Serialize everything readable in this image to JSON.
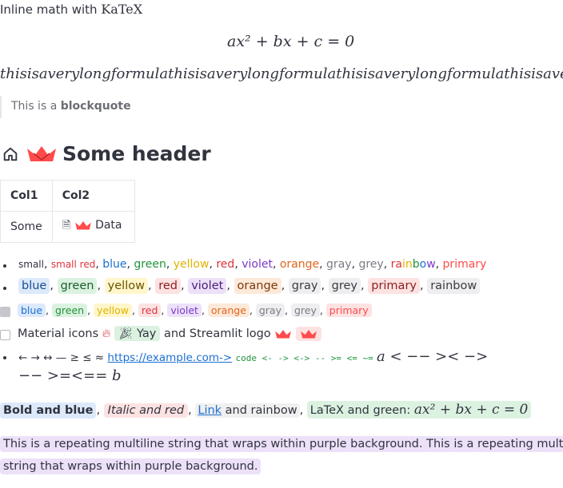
{
  "inline_math": {
    "prefix": "Inline math with ",
    "katex": "KaTeX"
  },
  "formula": "ax² + bx + c = 0",
  "long_formula": "thisisaverylongformulathisisaverylongformulathisisaverylongformulathisisave",
  "blockquote": {
    "prefix": "This is a ",
    "bold": "blockquote"
  },
  "header": {
    "title": "Some header"
  },
  "table": {
    "headers": [
      "Col1",
      "Col2"
    ],
    "rows": [
      [
        "Some",
        "Data"
      ]
    ]
  },
  "list1": {
    "small": "small",
    "small_red": "small red",
    "items": [
      {
        "text": "blue",
        "color": "#1c6fd1"
      },
      {
        "text": "green",
        "color": "#21943c"
      },
      {
        "text": "yellow",
        "color": "#e1b400"
      },
      {
        "text": "red",
        "color": "#e0323a"
      },
      {
        "text": "violet",
        "color": "#7d38c9"
      },
      {
        "text": "orange",
        "color": "#e0661e"
      },
      {
        "text": "gray",
        "color": "#7b7c85"
      },
      {
        "text": "grey",
        "color": "#7b7c85"
      }
    ],
    "rainbow": "rainbow",
    "primary": "primary",
    "primary_color": "#ff4b4b"
  },
  "list2": [
    {
      "text": "blue",
      "bg": "#dbe9fb",
      "fg": "#1a4e8f"
    },
    {
      "text": "green",
      "bg": "#dcf2e1",
      "fg": "#1b5e2c"
    },
    {
      "text": "yellow",
      "bg": "#fff6cc",
      "fg": "#6a5500"
    },
    {
      "text": "red",
      "bg": "#fde2e2",
      "fg": "#8a1d1d"
    },
    {
      "text": "violet",
      "bg": "#ece1f8",
      "fg": "#4b1e7a"
    },
    {
      "text": "orange",
      "bg": "#fde9d9",
      "fg": "#7a3a0c"
    },
    {
      "text": "gray",
      "bg": "#eeeef0",
      "fg": "#3a3b42"
    },
    {
      "text": "grey",
      "bg": "#eeeef0",
      "fg": "#3a3b42"
    },
    {
      "text": "primary",
      "bg": "#fde2e2",
      "fg": "#8a1d1d"
    },
    {
      "text": "rainbow",
      "bg": "#eeeef0",
      "fg": "#3a3b42"
    }
  ],
  "list3": [
    {
      "text": "blue",
      "bg": "#dbe9fb",
      "fg": "#1c6fd1"
    },
    {
      "text": "green",
      "bg": "#dcf2e1",
      "fg": "#21943c"
    },
    {
      "text": "yellow",
      "bg": "#fff6cc",
      "fg": "#e1b400"
    },
    {
      "text": "red",
      "bg": "#fde2e2",
      "fg": "#e0323a"
    },
    {
      "text": "violet",
      "bg": "#ece1f8",
      "fg": "#7d38c9"
    },
    {
      "text": "orange",
      "bg": "#fde9d9",
      "fg": "#e0661e"
    },
    {
      "text": "gray",
      "bg": "#eeeef0",
      "fg": "#7b7c85"
    },
    {
      "text": "grey",
      "bg": "#eeeef0",
      "fg": "#7b7c85"
    },
    {
      "text": "primary",
      "bg": "#fde2e2",
      "fg": "#ff4b4b"
    }
  ],
  "material": {
    "label": "Material icons",
    "yay": "Yay",
    "and_logo": "and Streamlit logo"
  },
  "arrows": {
    "symbols": "← → ↔ — ≥ ≤ ≈",
    "link": "https://example.com->",
    "code": "code <- -> <-> -- >= <= ~=",
    "math1": "a < −− >< −>",
    "math2": "−− >=<== b"
  },
  "mixed": {
    "bold_blue": "Bold and blue",
    "italic_red": "Italic and red",
    "link": "Link",
    "and_rainbow": "and rainbow",
    "latex_green": "LaTeX and green:",
    "latex_formula": "ax² + bx + c = 0"
  },
  "purple": {
    "line1": "This is a repeating multiline string that wraps within purple background. This is a repeating multiline",
    "line2": "string that wraps within purple background."
  }
}
